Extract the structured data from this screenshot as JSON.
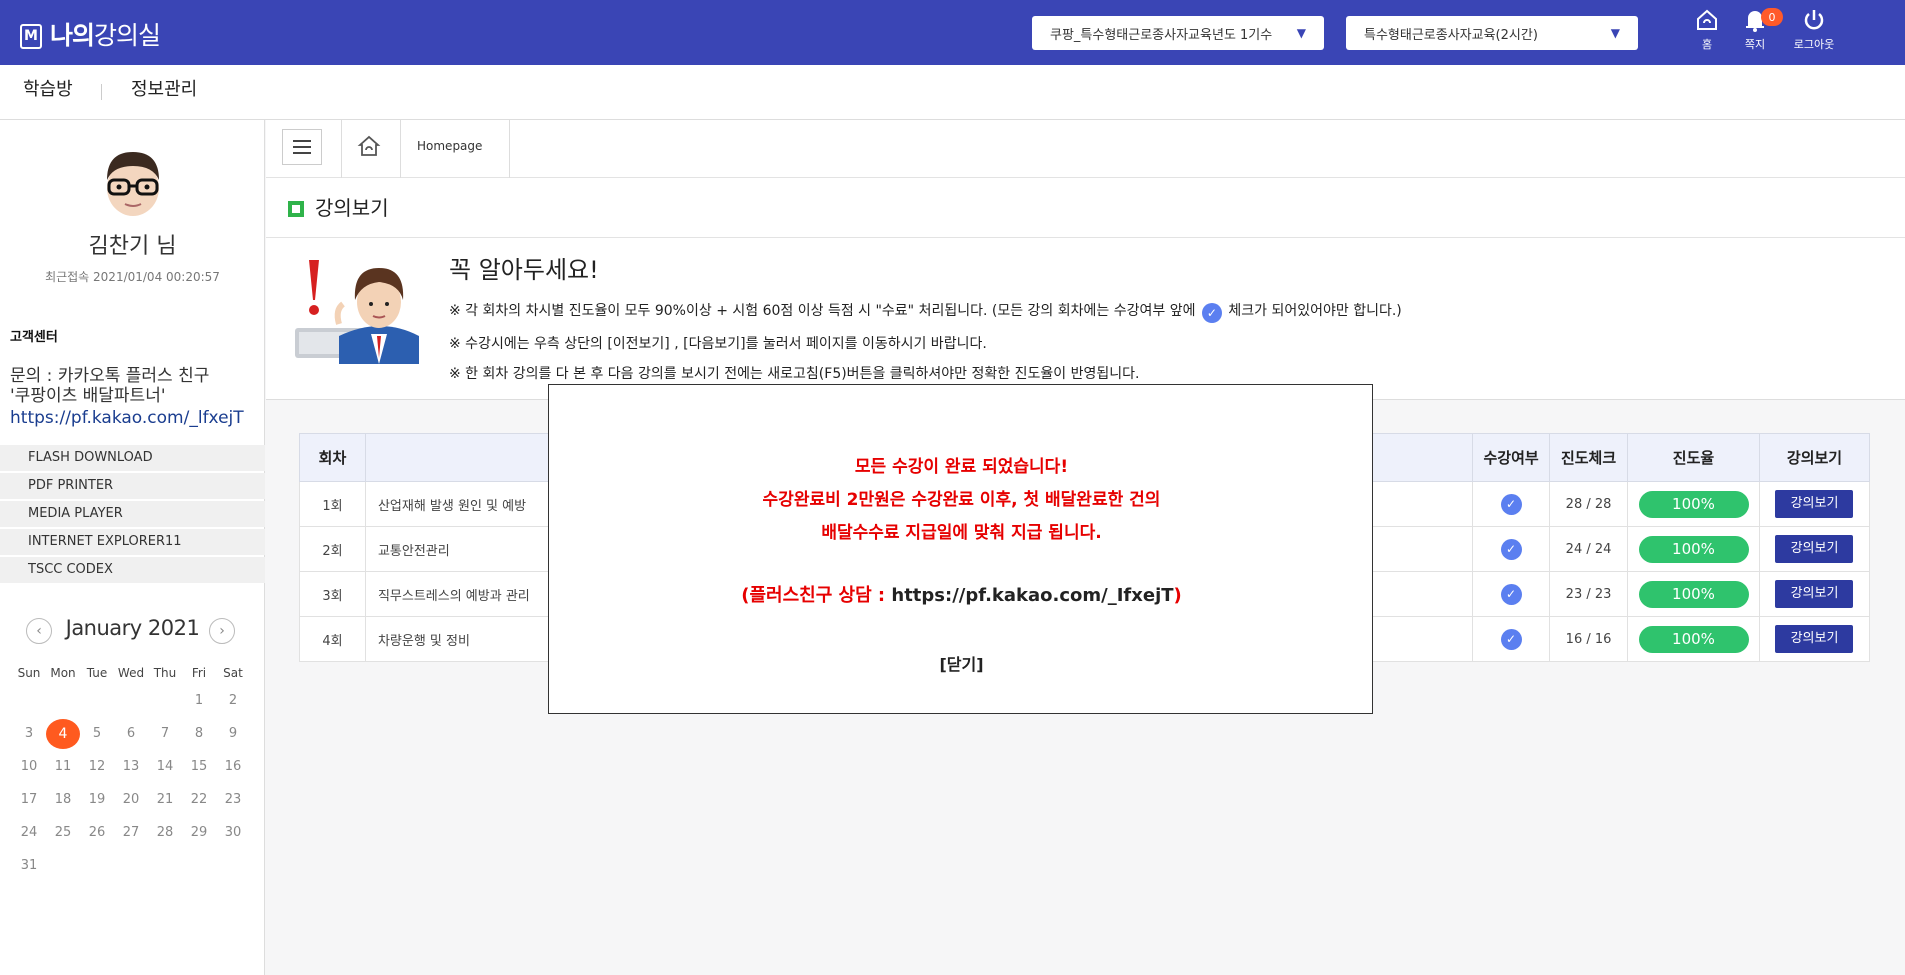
{
  "header": {
    "logo_bold": "나의",
    "logo_light": "강의실",
    "course_select": "쿠팡_특수형태근로종사자교육년도 1기수",
    "lecture_select": "특수형태근로종사자교육(2시간)",
    "home_label": "홈",
    "note_label": "쪽지",
    "note_count": "0",
    "logout_label": "로그아웃"
  },
  "subnav": {
    "item1": "학습방",
    "item2": "정보관리"
  },
  "sidebar": {
    "user_name": "김찬기 님",
    "last_login": "최근접속 2021/01/04 00:20:57",
    "cs_title": "고객센터",
    "cs_line1": "문의 : 카카오톡 플러스 친구",
    "cs_line2": "'쿠팡이츠 배달파트너'",
    "cs_link": "https://pf.kakao.com/_lfxejT",
    "plugins": [
      "FLASH DOWNLOAD",
      "PDF PRINTER",
      "MEDIA PLAYER",
      "INTERNET EXPLORER11",
      "TSCC CODEX"
    ]
  },
  "calendar": {
    "title": "January 2021",
    "days": [
      "Sun",
      "Mon",
      "Tue",
      "Wed",
      "Thu",
      "Fri",
      "Sat"
    ],
    "weeks": [
      [
        "",
        "",
        "",
        "",
        "",
        "1",
        "2"
      ],
      [
        "3",
        "4",
        "5",
        "6",
        "7",
        "8",
        "9"
      ],
      [
        "10",
        "11",
        "12",
        "13",
        "14",
        "15",
        "16"
      ],
      [
        "17",
        "18",
        "19",
        "20",
        "21",
        "22",
        "23"
      ],
      [
        "24",
        "25",
        "26",
        "27",
        "28",
        "29",
        "30"
      ],
      [
        "31",
        "",
        "",
        "",
        "",
        "",
        ""
      ]
    ],
    "today": "4"
  },
  "breadcrumb": {
    "current": "Homepage"
  },
  "section_title": "강의보기",
  "notice": {
    "title": "꼭 알아두세요!",
    "line1_a": "※ 각 회차의 차시별 진도율이 모두 90%이상 + 시험 60점 이상 득점 시 \"수료\" 처리됩니다. (모든 강의 회차에는 수강여부 앞에",
    "line1_b": "체크가 되어있어야만 합니다.)",
    "line2": "※ 수강시에는 우측 상단의 [이전보기] , [다음보기]를 눌러서 페이지를 이동하시기 바랍니다.",
    "line3": "※ 한 회차 강의를 다 본 후 다음 강의를 보시기 전에는 새로고침(F5)버튼을 클릭하셔야만 정확한 진도율이 반영됩니다."
  },
  "table": {
    "headers": {
      "round": "회차",
      "status": "수강여부",
      "check": "진도체크",
      "rate": "진도율",
      "view": "강의보기"
    },
    "rows": [
      {
        "round": "1회",
        "title": "산업재해 발생 원인 및 예방",
        "check": "28 / 28",
        "rate": "100%",
        "view": "강의보기"
      },
      {
        "round": "2회",
        "title": "교통안전관리",
        "check": "24 / 24",
        "rate": "100%",
        "view": "강의보기"
      },
      {
        "round": "3회",
        "title": "직무스트레스의 예방과 관리",
        "check": "23 / 23",
        "rate": "100%",
        "view": "강의보기"
      },
      {
        "round": "4회",
        "title": "차량운행 및 정비",
        "check": "16 / 16",
        "rate": "100%",
        "view": "강의보기"
      }
    ]
  },
  "modal": {
    "line1": "모든 수강이 완료 되었습니다!",
    "line2": "수강완료비 2만원은 수강완료 이후, 첫 배달완료한 건의",
    "line3": "배달수수료 지급일에 맞춰 지급 됩니다.",
    "contact_prefix": "(플러스친구 상담 : ",
    "contact_url": "https://pf.kakao.com/_IfxejT",
    "contact_suffix": ")",
    "close": "[닫기]"
  },
  "colors": {
    "header_bg": "#3a45b5",
    "accent_green": "#2fc36d",
    "check_blue": "#5b7ff0",
    "today_orange": "#ff5a1f",
    "modal_red": "#e60000"
  }
}
